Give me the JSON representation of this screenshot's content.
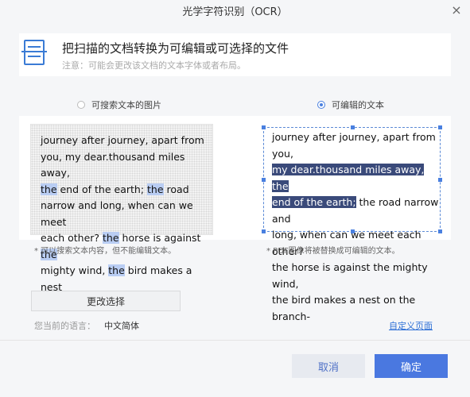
{
  "window": {
    "title": "光学字符识别（OCR）",
    "close_glyph": "×"
  },
  "header": {
    "title": "把扫描的文档转换为可编辑或可选择的文件",
    "note": "注意：可能会更改该文档的文本字体或者布局。"
  },
  "options": {
    "searchable_image": "可搜索文本的图片",
    "editable_text": "可编辑的文本",
    "selected": "editable_text"
  },
  "image_preview": {
    "lines": [
      [
        "journey after journey, apart from"
      ],
      [
        "you, my dear.thousand miles away,"
      ],
      [
        "",
        "the",
        " end of the earth; ",
        "the",
        " road"
      ],
      [
        "narrow and long, when can we meet"
      ],
      [
        "each other? ",
        "the",
        " horse is against ",
        "the"
      ],
      [
        "mighty wind, ",
        "the",
        " bird makes a nest"
      ]
    ]
  },
  "text_preview": {
    "line1": "journey after journey, apart from you,",
    "line2_selected": "my dear.thousand miles away, the",
    "line3_selected": "end of the earth;",
    "line3_rest": " the road narrow and",
    "line4": "long, when can we meet each other?",
    "line5": "the horse is against the mighty wind,",
    "line6": "the bird makes a nest on the branch-"
  },
  "hints": {
    "left": "* 可以搜索文本内容，但不能编辑文本。",
    "right": "* PDF图像将被替换成可编辑的文本。"
  },
  "change_button": "更改选择",
  "language": {
    "label": "您当前的语言：",
    "value": "中文简体"
  },
  "custom_link": "自定义页面",
  "buttons": {
    "cancel": "取消",
    "ok": "确定"
  },
  "colors": {
    "accent": "#4a78e0",
    "highlight": "#b9cdf3",
    "selection": "#3a4a7a"
  }
}
